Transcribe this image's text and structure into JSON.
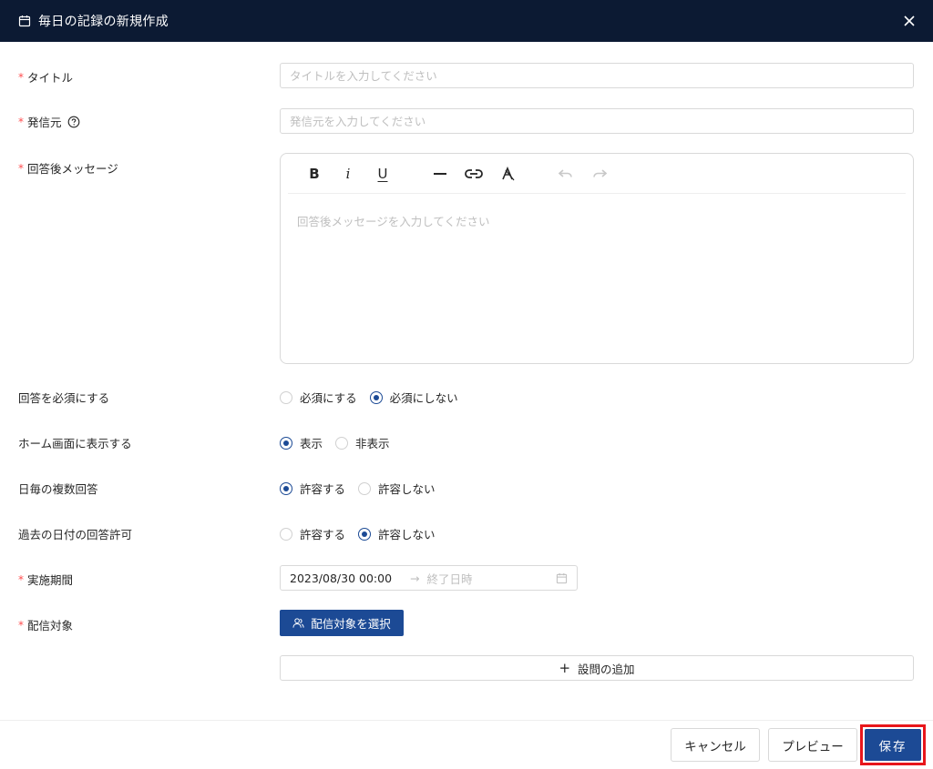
{
  "modal": {
    "title": "毎日の記録の新規作成",
    "icon": "calendar-icon",
    "close_icon": "close-icon"
  },
  "fields": {
    "title": {
      "label": "タイトル",
      "required": true,
      "placeholder": "タイトルを入力してください",
      "value": ""
    },
    "sender": {
      "label": "発信元",
      "required": true,
      "placeholder": "発信元を入力してください",
      "value": "",
      "help_icon": "question-circle-icon"
    },
    "reply_message": {
      "label": "回答後メッセージ",
      "required": true,
      "placeholder": "回答後メッセージを入力してください",
      "toolbar": {
        "bold": "B",
        "italic": "i",
        "underline": "U",
        "hr": "horizontal-rule-icon",
        "link": "link-icon",
        "clear_format": "clear-format-icon",
        "undo": "undo-icon",
        "redo": "redo-icon"
      }
    },
    "answer_required": {
      "label": "回答を必須にする",
      "options": [
        "必須にする",
        "必須にしない"
      ],
      "selected": "必須にしない"
    },
    "show_home": {
      "label": "ホーム画面に表示する",
      "options": [
        "表示",
        "非表示"
      ],
      "selected": "表示"
    },
    "multiple_answers": {
      "label": "日毎の複数回答",
      "options": [
        "許容する",
        "許容しない"
      ],
      "selected": "許容する"
    },
    "past_date": {
      "label": "過去の日付の回答許可",
      "options": [
        "許容する",
        "許容しない"
      ],
      "selected": "許容しない"
    },
    "period": {
      "label": "実施期間",
      "required": true,
      "start": "2023/08/30 00:00",
      "end_placeholder": "終了日時"
    },
    "target": {
      "label": "配信対象",
      "required": true,
      "button": "配信対象を選択"
    }
  },
  "add_question": "設問の追加",
  "footer": {
    "cancel": "キャンセル",
    "preview": "プレビュー",
    "save": "保存"
  },
  "colors": {
    "header_bg": "#0c1a33",
    "primary": "#1c4a95",
    "required_mark": "#ff4d4f",
    "highlight": "#e8161b"
  }
}
